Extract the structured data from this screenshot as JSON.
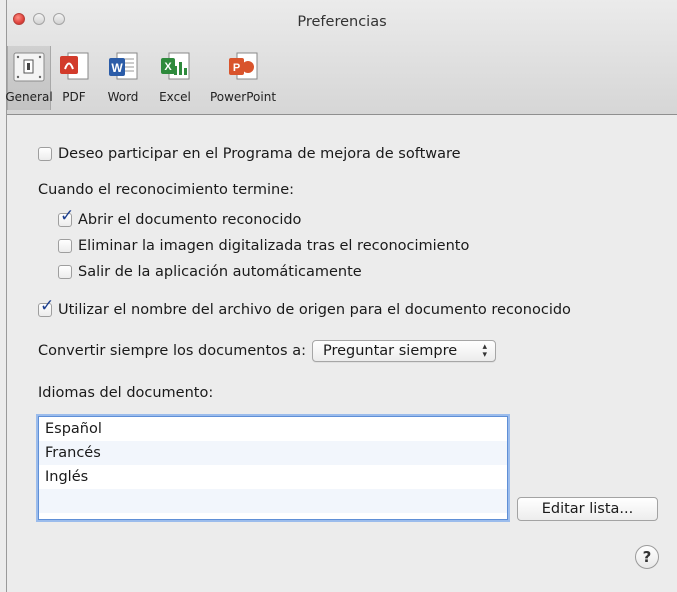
{
  "window": {
    "title": "Preferencias"
  },
  "toolbar": {
    "tabs": [
      {
        "label": "General",
        "icon": "general-icon",
        "selected": true
      },
      {
        "label": "PDF",
        "icon": "pdf-icon",
        "color": "#d23b2b"
      },
      {
        "label": "Word",
        "icon": "word-icon",
        "color": "#2b5ca8"
      },
      {
        "label": "Excel",
        "icon": "excel-icon",
        "color": "#2e8a3c"
      },
      {
        "label": "PowerPoint",
        "icon": "powerpoint-icon",
        "color": "#d9542c"
      }
    ]
  },
  "general": {
    "improvement_program": {
      "label": "Deseo participar en el Programa de mejora de software",
      "checked": false
    },
    "on_finish_heading": "Cuando el reconocimiento termine:",
    "open_document": {
      "label": "Abrir el documento reconocido",
      "checked": true
    },
    "delete_image": {
      "label": "Eliminar la imagen digitalizada tras el reconocimiento",
      "checked": false
    },
    "quit_app": {
      "label": "Salir de la aplicación automáticamente",
      "checked": false
    },
    "use_source_name": {
      "label": "Utilizar el nombre del archivo de origen para el documento reconocido",
      "checked": true
    },
    "convert_label": "Convertir siempre los documentos a:",
    "convert_value": "Preguntar siempre",
    "languages_heading": "Idiomas del documento:",
    "languages": [
      "Español",
      "Francés",
      "Inglés"
    ],
    "edit_list_button": "Editar lista...",
    "help_button": "?"
  }
}
